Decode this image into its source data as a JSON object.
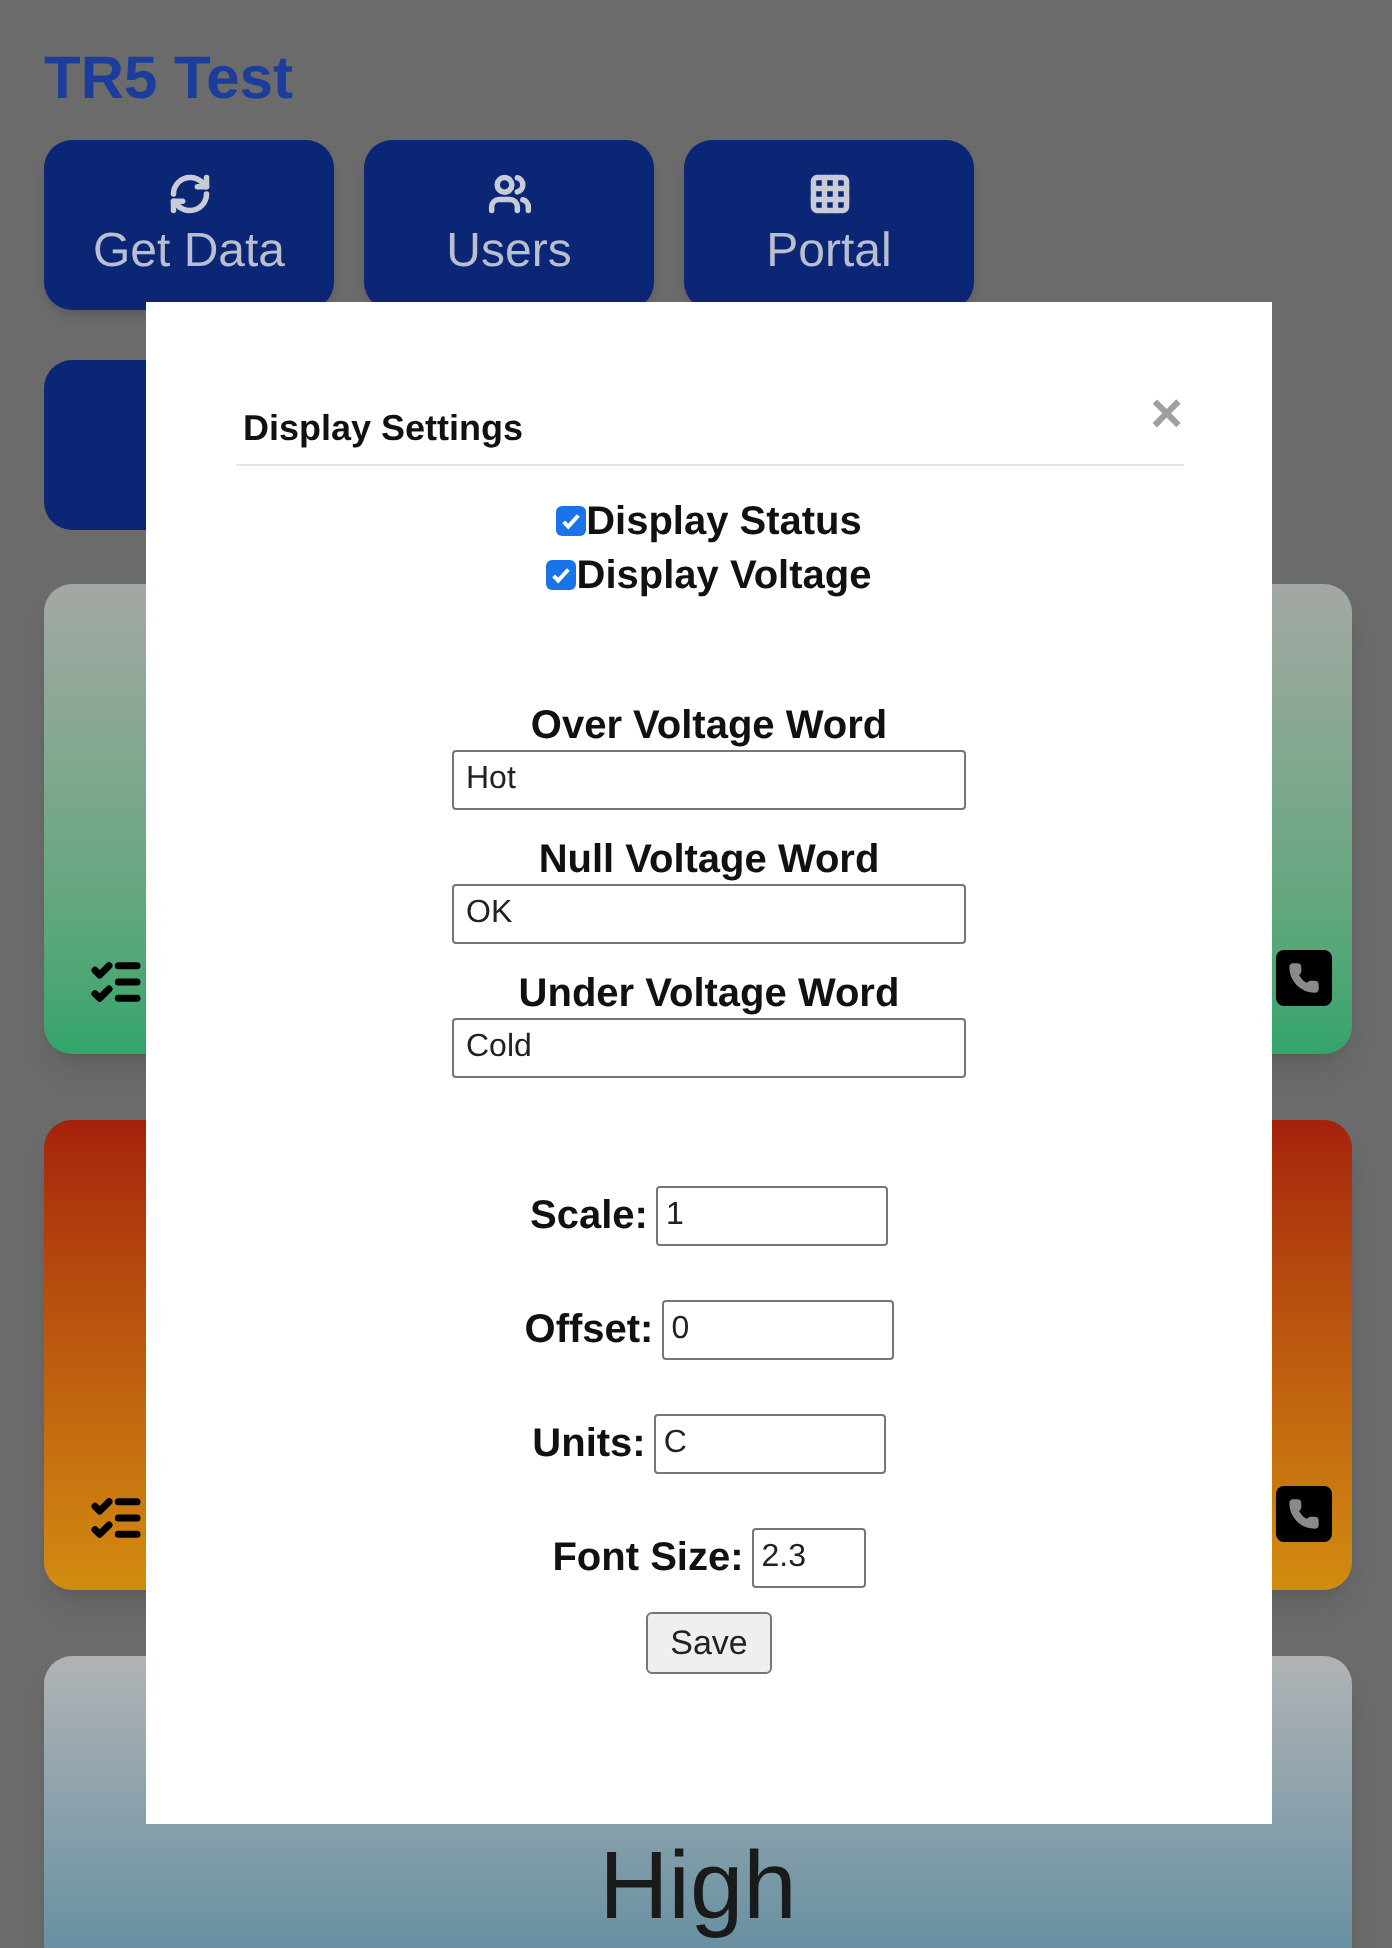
{
  "page": {
    "title": "TR5 Test",
    "buttons": [
      {
        "kind": "refresh",
        "label": "Get Data"
      },
      {
        "kind": "users",
        "label": "Users"
      },
      {
        "kind": "grid",
        "label": "Portal"
      }
    ],
    "cards": [
      {
        "kind": "ok"
      },
      {
        "kind": "alarm"
      },
      {
        "kind": "info",
        "reading": "High"
      }
    ]
  },
  "dialog": {
    "title": "Display Settings",
    "close": "×",
    "checkboxes": [
      {
        "label": "Display Status",
        "checked": true
      },
      {
        "label": "Display Voltage",
        "checked": true
      }
    ],
    "word_fields": [
      {
        "label": "Over Voltage Word",
        "value": "Hot"
      },
      {
        "label": "Null Voltage Word",
        "value": "OK"
      },
      {
        "label": "Under Voltage Word",
        "value": "Cold"
      }
    ],
    "settings": [
      {
        "kind": "wide",
        "label": "Scale:",
        "value": "1"
      },
      {
        "kind": "wide",
        "label": "Offset:",
        "value": "0"
      },
      {
        "kind": "wide",
        "label": "Units:",
        "value": "C"
      },
      {
        "kind": "narrow",
        "label": "Font Size:",
        "value": "2.3"
      }
    ],
    "save": "Save"
  }
}
